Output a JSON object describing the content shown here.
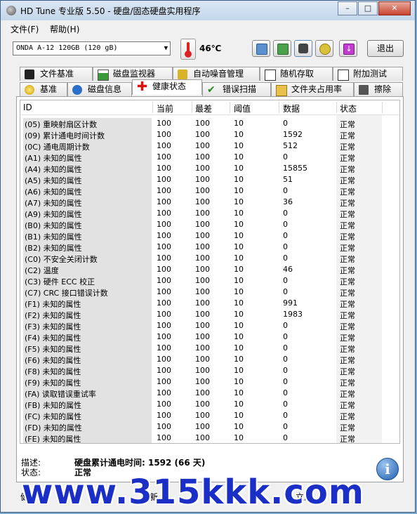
{
  "window": {
    "title": "HD Tune 专业版 5.50 - 硬盘/固态硬盘实用程序",
    "min": "–",
    "max": "□",
    "close": "✕"
  },
  "menu": {
    "file": "文件(F)",
    "help": "帮助(H)"
  },
  "toolbar": {
    "drive": "ONDA    A-12 120GB (120 gB)",
    "temperature": "46℃",
    "exit": "退出"
  },
  "tabs_top": [
    {
      "label": "文件基准",
      "icon": "file-benchmark-icon"
    },
    {
      "label": "磁盘监视器",
      "icon": "disk-monitor-icon"
    },
    {
      "label": "自动噪音管理",
      "icon": "speaker-icon"
    },
    {
      "label": "随机存取",
      "icon": "random-access-icon"
    },
    {
      "label": "附加测试",
      "icon": "extra-tests-icon"
    }
  ],
  "tabs_bottom": [
    {
      "label": "基准",
      "icon": "benchmark-icon"
    },
    {
      "label": "磁盘信息",
      "icon": "info-small-icon"
    },
    {
      "label": "健康状态",
      "icon": "health-cross-icon"
    },
    {
      "label": "错误扫描",
      "icon": "check-icon"
    },
    {
      "label": "文件夹占用率",
      "icon": "folder-icon"
    },
    {
      "label": "擦除",
      "icon": "trash-icon"
    }
  ],
  "table": {
    "headers": {
      "id": "ID",
      "current": "当前",
      "worst": "最差",
      "threshold": "阈值",
      "data": "数据",
      "status": "状态"
    },
    "rows": [
      {
        "id": "(05) 重映射扇区计数",
        "current": "100",
        "worst": "100",
        "threshold": "10",
        "data": "0",
        "status": "正常"
      },
      {
        "id": "(09) 累计通电时间计数",
        "current": "100",
        "worst": "100",
        "threshold": "10",
        "data": "1592",
        "status": "正常"
      },
      {
        "id": "(0C) 通电周期计数",
        "current": "100",
        "worst": "100",
        "threshold": "10",
        "data": "512",
        "status": "正常"
      },
      {
        "id": "(A1) 未知的属性",
        "current": "100",
        "worst": "100",
        "threshold": "10",
        "data": "0",
        "status": "正常"
      },
      {
        "id": "(A4) 未知的属性",
        "current": "100",
        "worst": "100",
        "threshold": "10",
        "data": "15855",
        "status": "正常"
      },
      {
        "id": "(A5) 未知的属性",
        "current": "100",
        "worst": "100",
        "threshold": "10",
        "data": "51",
        "status": "正常"
      },
      {
        "id": "(A6) 未知的属性",
        "current": "100",
        "worst": "100",
        "threshold": "10",
        "data": "0",
        "status": "正常"
      },
      {
        "id": "(A7) 未知的属性",
        "current": "100",
        "worst": "100",
        "threshold": "10",
        "data": "36",
        "status": "正常"
      },
      {
        "id": "(A9) 未知的属性",
        "current": "100",
        "worst": "100",
        "threshold": "10",
        "data": "0",
        "status": "正常"
      },
      {
        "id": "(B0) 未知的属性",
        "current": "100",
        "worst": "100",
        "threshold": "10",
        "data": "0",
        "status": "正常"
      },
      {
        "id": "(B1) 未知的属性",
        "current": "100",
        "worst": "100",
        "threshold": "10",
        "data": "0",
        "status": "正常"
      },
      {
        "id": "(B2) 未知的属性",
        "current": "100",
        "worst": "100",
        "threshold": "10",
        "data": "0",
        "status": "正常"
      },
      {
        "id": "(C0) 不安全关闭计数",
        "current": "100",
        "worst": "100",
        "threshold": "10",
        "data": "0",
        "status": "正常"
      },
      {
        "id": "(C2) 温度",
        "current": "100",
        "worst": "100",
        "threshold": "10",
        "data": "46",
        "status": "正常"
      },
      {
        "id": "(C3) 硬件 ECC 校正",
        "current": "100",
        "worst": "100",
        "threshold": "10",
        "data": "0",
        "status": "正常"
      },
      {
        "id": "(C7) CRC 接口错误计数",
        "current": "100",
        "worst": "100",
        "threshold": "10",
        "data": "0",
        "status": "正常"
      },
      {
        "id": "(F1) 未知的属性",
        "current": "100",
        "worst": "100",
        "threshold": "10",
        "data": "991",
        "status": "正常"
      },
      {
        "id": "(F2) 未知的属性",
        "current": "100",
        "worst": "100",
        "threshold": "10",
        "data": "1983",
        "status": "正常"
      },
      {
        "id": "(F3) 未知的属性",
        "current": "100",
        "worst": "100",
        "threshold": "10",
        "data": "0",
        "status": "正常"
      },
      {
        "id": "(F4) 未知的属性",
        "current": "100",
        "worst": "100",
        "threshold": "10",
        "data": "0",
        "status": "正常"
      },
      {
        "id": "(F5) 未知的属性",
        "current": "100",
        "worst": "100",
        "threshold": "10",
        "data": "0",
        "status": "正常"
      },
      {
        "id": "(F6) 未知的属性",
        "current": "100",
        "worst": "100",
        "threshold": "10",
        "data": "0",
        "status": "正常"
      },
      {
        "id": "(F8) 未知的属性",
        "current": "100",
        "worst": "100",
        "threshold": "10",
        "data": "0",
        "status": "正常"
      },
      {
        "id": "(F9) 未知的属性",
        "current": "100",
        "worst": "100",
        "threshold": "10",
        "data": "0",
        "status": "正常"
      },
      {
        "id": "(FA) 读取错误重试率",
        "current": "100",
        "worst": "100",
        "threshold": "10",
        "data": "0",
        "status": "正常"
      },
      {
        "id": "(FB) 未知的属性",
        "current": "100",
        "worst": "100",
        "threshold": "10",
        "data": "0",
        "status": "正常"
      },
      {
        "id": "(FC) 未知的属性",
        "current": "100",
        "worst": "100",
        "threshold": "10",
        "data": "0",
        "status": "正常"
      },
      {
        "id": "(FD) 未知的属性",
        "current": "100",
        "worst": "100",
        "threshold": "10",
        "data": "0",
        "status": "正常"
      },
      {
        "id": "(FE) 未知的属性",
        "current": "100",
        "worst": "100",
        "threshold": "10",
        "data": "0",
        "status": "正常"
      }
    ]
  },
  "description": {
    "label": "描述:",
    "value": "硬盘累计通电时间: 1592 (66 天)"
  },
  "status": {
    "label": "状态:",
    "value": "正常"
  },
  "statusbar": {
    "left": "健康状",
    "mid": "刷新",
    "right": "立即"
  },
  "watermark": "www.315kkk.com",
  "colors": {
    "watermark": "#1b2fc7",
    "info_icon": "#1f5fae",
    "temp_red": "#dd2222"
  }
}
